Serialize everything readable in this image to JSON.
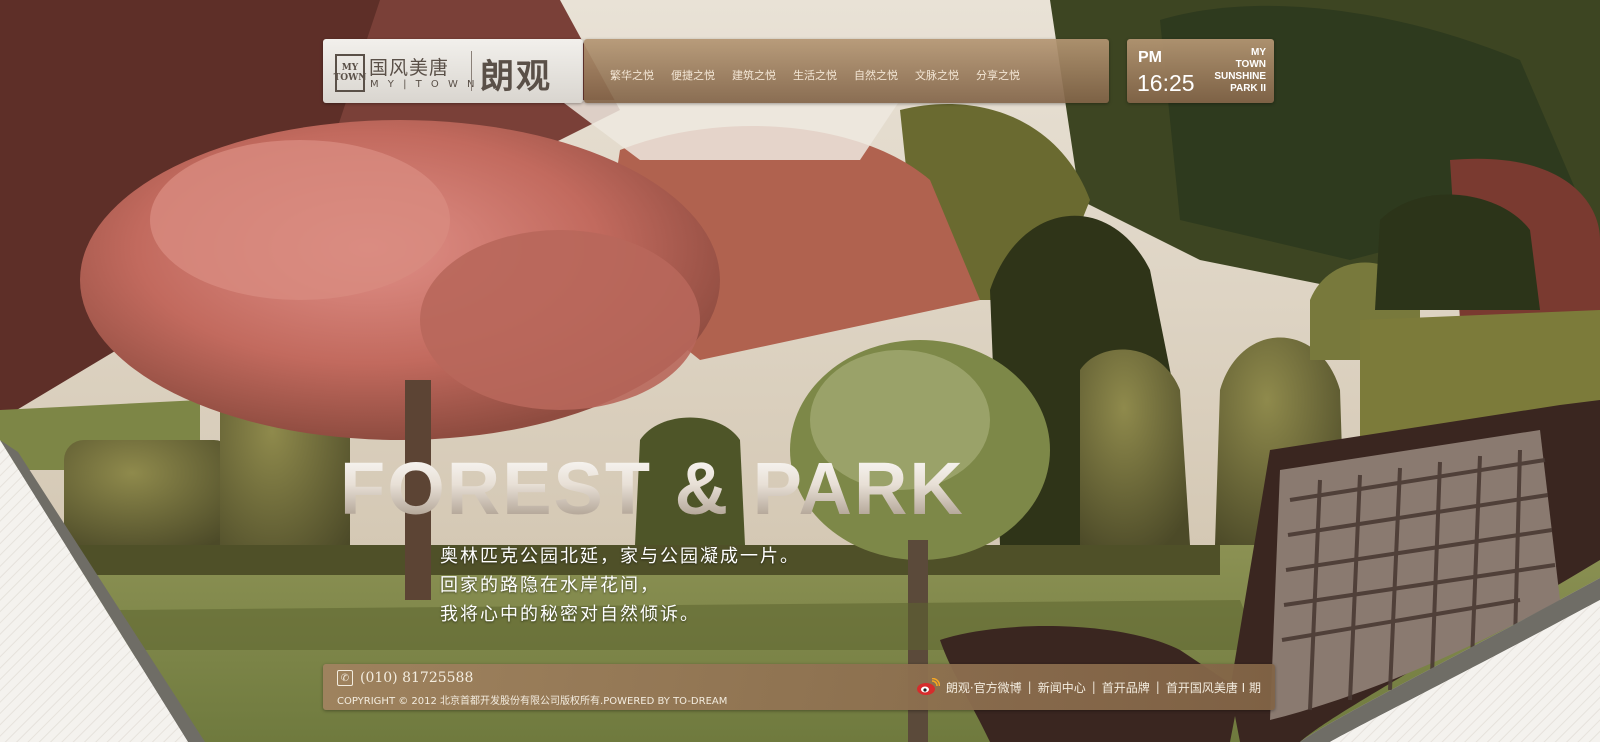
{
  "logo": {
    "mark": "MY TOWN",
    "cn": "国风美唐",
    "en": "M Y | T O W N",
    "brand": "朗观"
  },
  "nav": {
    "items": [
      "繁华之悦",
      "便捷之悦",
      "建筑之悦",
      "生活之悦",
      "自然之悦",
      "文脉之悦",
      "分享之悦"
    ]
  },
  "clock": {
    "ampm": "PM",
    "time": "16:25",
    "tag": [
      "MY",
      "TOWN",
      "SUNSHINE",
      "PARK II"
    ]
  },
  "hero": {
    "title": "FOREST & PARK",
    "lines": [
      "奥林匹克公园北延，家与公园凝成一片。",
      "回家的路隐在水岸花间，",
      "我将心中的秘密对自然倾诉。"
    ]
  },
  "footer": {
    "phone": "(010) 81725588",
    "copyright": "COPYRIGHT © 2012 北京首都开发股份有限公司版权所有.POWERED BY TO-DREAM",
    "links": [
      "朗观·官方微博",
      "新闻中心",
      "首开品牌",
      "首开国风美唐 I 期"
    ]
  },
  "colors": {
    "accent": "#9c7f5f",
    "nav_text": "#f3e6d5"
  }
}
